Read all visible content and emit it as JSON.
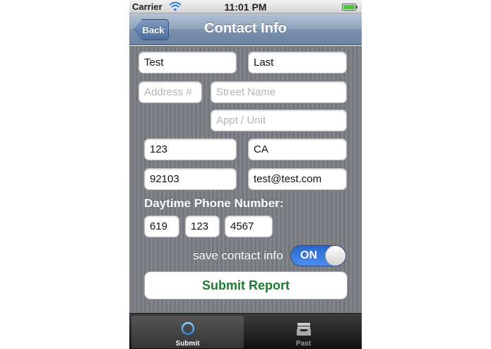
{
  "status_bar": {
    "carrier": "Carrier",
    "time": "11:01 PM"
  },
  "nav": {
    "back_label": "Back",
    "title": "Contact Info"
  },
  "form": {
    "first_name": {
      "value": "Test"
    },
    "last_name": {
      "value": "Last"
    },
    "address_number": {
      "placeholder": "Address #"
    },
    "street_name": {
      "placeholder": "Street Name"
    },
    "appt_unit": {
      "placeholder": "Appt / Unit"
    },
    "city": {
      "value": "123"
    },
    "state": {
      "value": "CA"
    },
    "zip": {
      "value": "92103"
    },
    "email": {
      "value": "test@test.com"
    },
    "phone_label": "Daytime Phone Number:",
    "phone_area": {
      "value": "619"
    },
    "phone_prefix": {
      "value": "123"
    },
    "phone_line": {
      "value": "4567"
    },
    "save_contact_label": "save contact info",
    "save_contact_toggle": "ON",
    "submit_label": "Submit Report"
  },
  "tabs": [
    {
      "label": "Submit",
      "icon": "crosshair-icon",
      "selected": true
    },
    {
      "label": "Past",
      "icon": "inbox-tray-icon",
      "selected": false
    }
  ],
  "colors": {
    "submit_text": "#1f7a32",
    "toggle_on": "#2a66c8",
    "nav_bar": "#7c91ac"
  }
}
